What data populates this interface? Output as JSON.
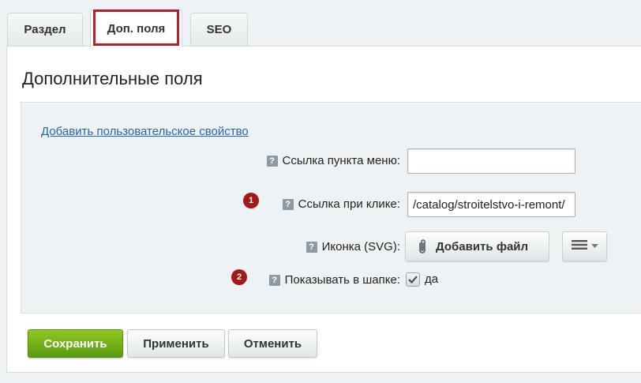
{
  "tabs": [
    {
      "label": "Раздел"
    },
    {
      "label": "Доп. поля"
    },
    {
      "label": "SEO"
    }
  ],
  "panel": {
    "title": "Дополнительные поля",
    "add_property_link": "Добавить пользовательское свойство"
  },
  "fields": {
    "menu_link": {
      "label": "Ссылка пункта меню:",
      "value": ""
    },
    "click_link": {
      "label": "Ссылка при клике:",
      "value": "/catalog/stroitelstvo-i-remont/"
    },
    "icon": {
      "label": "Иконка (SVG):",
      "button_label": "Добавить файл"
    },
    "show_in_header": {
      "label": "Показывать в шапке:",
      "checked": true,
      "option_label": "да"
    }
  },
  "markers": [
    "1",
    "2"
  ],
  "help_glyph": "?",
  "buttons": {
    "save": "Сохранить",
    "apply": "Применить",
    "cancel": "Отменить"
  },
  "colors": {
    "accent_highlight": "#b5202a",
    "marker": "#a31919",
    "save_button": "#6aab17",
    "link": "#2067b0"
  }
}
